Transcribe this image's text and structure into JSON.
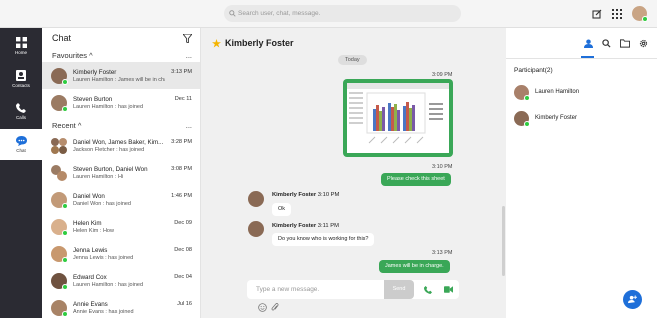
{
  "search": {
    "placeholder": "Search user, chat, message."
  },
  "rail": {
    "items": [
      {
        "label": "Home",
        "icon": "grid-icon"
      },
      {
        "label": "Contacts",
        "icon": "contacts-icon"
      },
      {
        "label": "Calls",
        "icon": "phone-icon"
      },
      {
        "label": "Chat",
        "icon": "chat-icon"
      }
    ]
  },
  "chatlist": {
    "title": "Chat",
    "favourites": {
      "label": "Favourites ^",
      "more": "..."
    },
    "recent": {
      "label": "Recent ^",
      "more": "..."
    },
    "favs": [
      {
        "name": "Kimberly Foster",
        "msg": "Lauren Hamilton : James will be in charge.",
        "time": "3:13 PM"
      },
      {
        "name": "Steven Burton",
        "msg": "Lauren Hamilton : has joined",
        "time": "Dec 11"
      }
    ],
    "recents": [
      {
        "name": "Daniel Won, James Baker, Kim...",
        "msg": "Jackson Fletcher : has joined",
        "time": "3:28 PM"
      },
      {
        "name": "Steven Burton, Daniel Won",
        "msg": "Lauren Hamilton : Hi",
        "time": "3:08 PM"
      },
      {
        "name": "Daniel Won",
        "msg": "Daniel Won : has joined",
        "time": "1:46 PM"
      },
      {
        "name": "Helen Kim",
        "msg": "Helen Kim : How",
        "time": "Dec 09"
      },
      {
        "name": "Jenna Lewis",
        "msg": "Jenna Lewis : has joined",
        "time": "Dec 08"
      },
      {
        "name": "Edward Cox",
        "msg": "Lauren Hamilton : has joined",
        "time": "Dec 04"
      },
      {
        "name": "Annie Evans",
        "msg": "Annie Evans : has joined",
        "time": "Jul 16"
      }
    ]
  },
  "conversation": {
    "title": "Kimberly Foster",
    "day": "Today",
    "img_time": "3:09 PM",
    "check_time": "3:10 PM",
    "check_msg": "Please check this sheet",
    "m1_sender": "Kimberly Foster",
    "m1_time": "3:10 PM",
    "m1_text": "Ok",
    "m2_sender": "Kimberly Foster",
    "m2_time": "3:11 PM",
    "m2_text": "Do you know who is working for this?",
    "last_time": "3:13 PM",
    "last_msg": "James will be in charge.",
    "composer_placeholder": "Type a new message.",
    "send_label": "Send"
  },
  "participants": {
    "title": "Participant(2)",
    "list": [
      "Lauren Hamilton",
      "Kimberly Foster"
    ]
  },
  "colors": {
    "accent": "#1e6fd9",
    "green": "#3aa757",
    "rail": "#2b2b33",
    "star": "#f5b400"
  }
}
